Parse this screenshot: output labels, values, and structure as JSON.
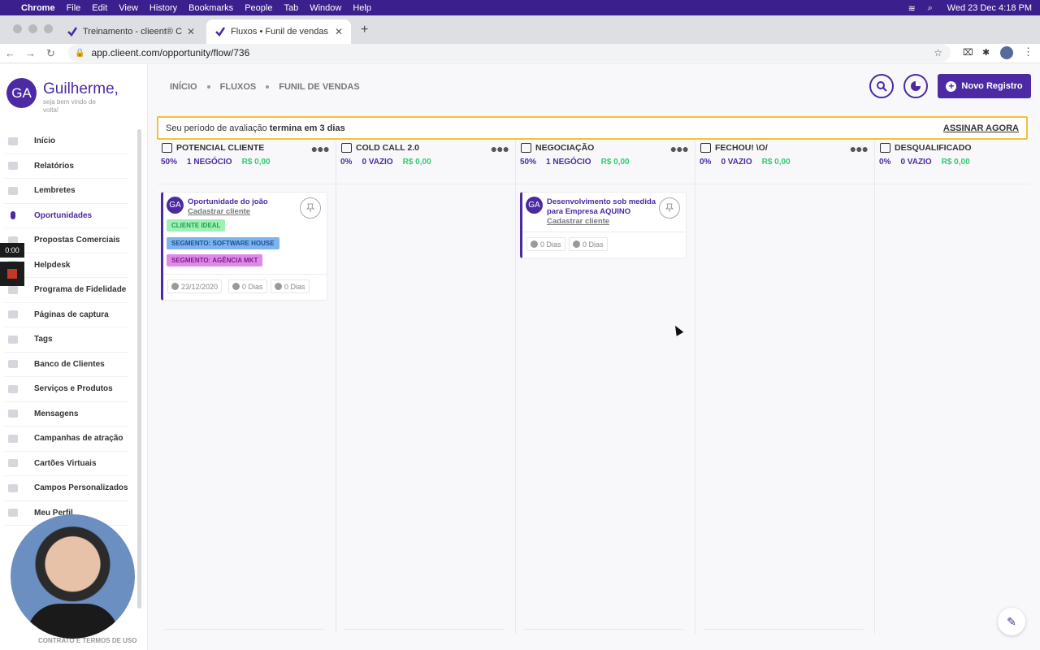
{
  "menubar": {
    "app": "Chrome",
    "items": [
      "File",
      "Edit",
      "View",
      "History",
      "Bookmarks",
      "People",
      "Tab",
      "Window",
      "Help"
    ],
    "clock": "Wed 23 Dec  4:18 PM"
  },
  "browser": {
    "tabs": [
      {
        "title": "Treinamento - clieent® CRM"
      },
      {
        "title": "Fluxos • Funil de vendas • clieent"
      }
    ],
    "url": "app.clieent.com/opportunity/flow/736"
  },
  "sidebar": {
    "avatar_initials": "GA",
    "greeting": "Guilherme,",
    "subtitle": "seja bem vindo de volta!",
    "items": [
      {
        "label": "Início"
      },
      {
        "label": "Relatórios"
      },
      {
        "label": "Lembretes"
      },
      {
        "label": "Oportunidades"
      },
      {
        "label": "Propostas Comerciais"
      },
      {
        "label": "Helpdesk"
      },
      {
        "label": "Programa de Fidelidade"
      },
      {
        "label": "Páginas de captura"
      },
      {
        "label": "Tags"
      },
      {
        "label": "Banco de Clientes"
      },
      {
        "label": "Serviços e Produtos"
      },
      {
        "label": "Mensagens"
      },
      {
        "label": "Campanhas de atração"
      },
      {
        "label": "Cartões Virtuais"
      },
      {
        "label": "Campos Personalizados"
      },
      {
        "label": "Meu Perfil"
      }
    ],
    "active_item": "Oportunidades",
    "footer": "CONTRATO E TERMOS DE USO"
  },
  "recorder": {
    "time": "0:00"
  },
  "header": {
    "breadcrumb": [
      "INÍCIO",
      "FLUXOS",
      "FUNIL DE VENDAS"
    ],
    "new_button": "Novo Registro"
  },
  "trial": {
    "text": "Seu período de avaliação",
    "bold": "termina em 3 dias",
    "cta": "ASSINAR AGORA"
  },
  "columns": [
    {
      "title": "POTENCIAL CLIENTE",
      "pct": "50%",
      "count": "1 NEGÓCIO",
      "value": "R$ 0,00"
    },
    {
      "title": "COLD CALL 2.0",
      "pct": "0%",
      "count": "0 VAZIO",
      "value": "R$ 0,00"
    },
    {
      "title": "NEGOCIAÇÃO",
      "pct": "50%",
      "count": "1 NEGÓCIO",
      "value": "R$ 0,00"
    },
    {
      "title": "FECHOU! \\O/",
      "pct": "0%",
      "count": "0 VAZIO",
      "value": "R$ 0,00"
    },
    {
      "title": "DESQUALIFICADO",
      "pct": "0%",
      "count": "0 VAZIO",
      "value": "R$ 0,00"
    }
  ],
  "cards": {
    "card1": {
      "avatar": "GA",
      "title": "Oportunidade do joão",
      "link": "Cadastrar cliente",
      "tags": [
        "CLIENTE IDEAL",
        "SEGMENTO: SOFTWARE HOUSE",
        "SEGMENTO: AGÊNCIA MKT"
      ],
      "date": "23/12/2020",
      "days1": "0 Dias",
      "days2": "0 Dias"
    },
    "card2": {
      "avatar": "GA",
      "title": "Desenvolvimento sob medida para Empresa AQUINO",
      "link": "Cadastrar cliente",
      "days1": "0 Dias",
      "days2": "0 Dias"
    }
  },
  "colors": {
    "brand": "#4b2aa3",
    "positive": "#2ecc71",
    "warning_border": "#f0c23a"
  }
}
